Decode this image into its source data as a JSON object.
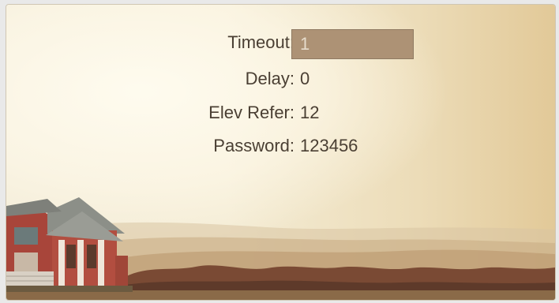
{
  "settings": {
    "timeout": {
      "label": "Timeout:",
      "value": "1"
    },
    "delay": {
      "label": "Delay:",
      "value": "0"
    },
    "elev_refer": {
      "label": "Elev Refer:",
      "value": "12"
    },
    "password": {
      "label": "Password:",
      "value": "123456"
    }
  },
  "colors": {
    "text": "#4a3f33",
    "field_bg": "#ad9275",
    "field_text": "#e7dccc"
  }
}
